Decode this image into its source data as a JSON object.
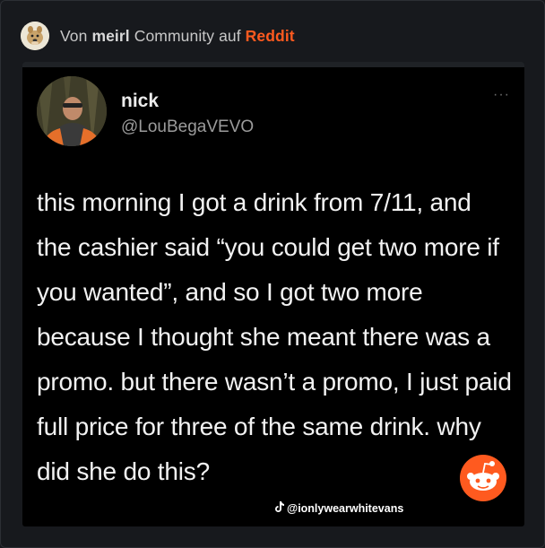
{
  "header": {
    "prefix": "Von ",
    "community": "meirl",
    "middle": " Community auf ",
    "platform": "Reddit"
  },
  "tweet": {
    "name": "nick",
    "handle": "@LouBegaVEVO",
    "more_label": "···",
    "text": "this morning I got a drink from 7/11, and the cashier said “you could get two more if you wanted”, and so I got two more because I thought she meant there was a promo. but there wasn’t a promo, I just paid full price for three of the same drink. why did she do this?",
    "watermark": "@ionlywearwhitevans"
  },
  "icons": {
    "community_avatar": "doge-avatar-icon",
    "profile_picture": "profile-photo",
    "tiktok": "tiktok-icon",
    "reddit_mascot": "reddit-snoo-icon"
  },
  "colors": {
    "reddit_accent": "#ff5a1f",
    "tweet_background": "#000000",
    "page_background": "#17191d"
  }
}
